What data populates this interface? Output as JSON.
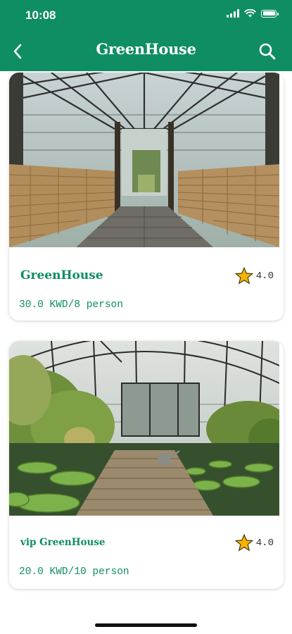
{
  "status_bar": {
    "time": "10:08"
  },
  "header": {
    "title": "GreenHouse"
  },
  "colors": {
    "brand": "#0f8d63",
    "star": "#f5b400"
  },
  "cards": [
    {
      "name": "GreenHouse",
      "rating": "4.0",
      "price": "30.0 KWD/8 person"
    },
    {
      "name": "vip GreenHouse",
      "rating": "4.0",
      "price": "20.0 KWD/10 person"
    }
  ]
}
